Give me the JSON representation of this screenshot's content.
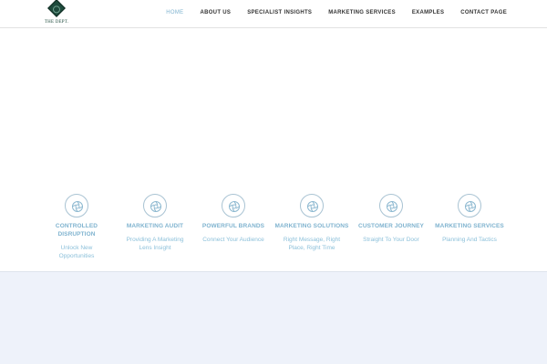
{
  "brand": {
    "logo_text": "THE DEPT."
  },
  "nav": {
    "items": [
      {
        "label": "HOME",
        "active": true
      },
      {
        "label": "ABOUT US",
        "active": false
      },
      {
        "label": "SPECIALIST INSIGHTS",
        "active": false
      },
      {
        "label": "MARKETING SERVICES",
        "active": false
      },
      {
        "label": "EXAMPLES",
        "active": false
      },
      {
        "label": "CONTACT PAGE",
        "active": false
      }
    ]
  },
  "features": [
    {
      "title": "CONTROLLED DISRUPTION",
      "description": "Unlock New Opportunities",
      "icon": "aperture-icon"
    },
    {
      "title": "MARKETING AUDIT",
      "description": "Providing A Marketing Lens Insight",
      "icon": "aperture-icon"
    },
    {
      "title": "POWERFUL BRANDS",
      "description": "Connect Your Audience",
      "icon": "aperture-icon"
    },
    {
      "title": "MARKETING SOLUTIONS",
      "description": "Right Message, Right Place, Right Time",
      "icon": "aperture-icon"
    },
    {
      "title": "CUSTOMER JOURNEY",
      "description": "Straight To Your Door",
      "icon": "aperture-icon"
    },
    {
      "title": "MARKETING SERVICES",
      "description": "Planning And Tactics",
      "icon": "aperture-icon"
    }
  ],
  "colors": {
    "accent": "#7fb3cf",
    "logo": "#1d4a3c",
    "lower_background": "#eef2fa"
  }
}
